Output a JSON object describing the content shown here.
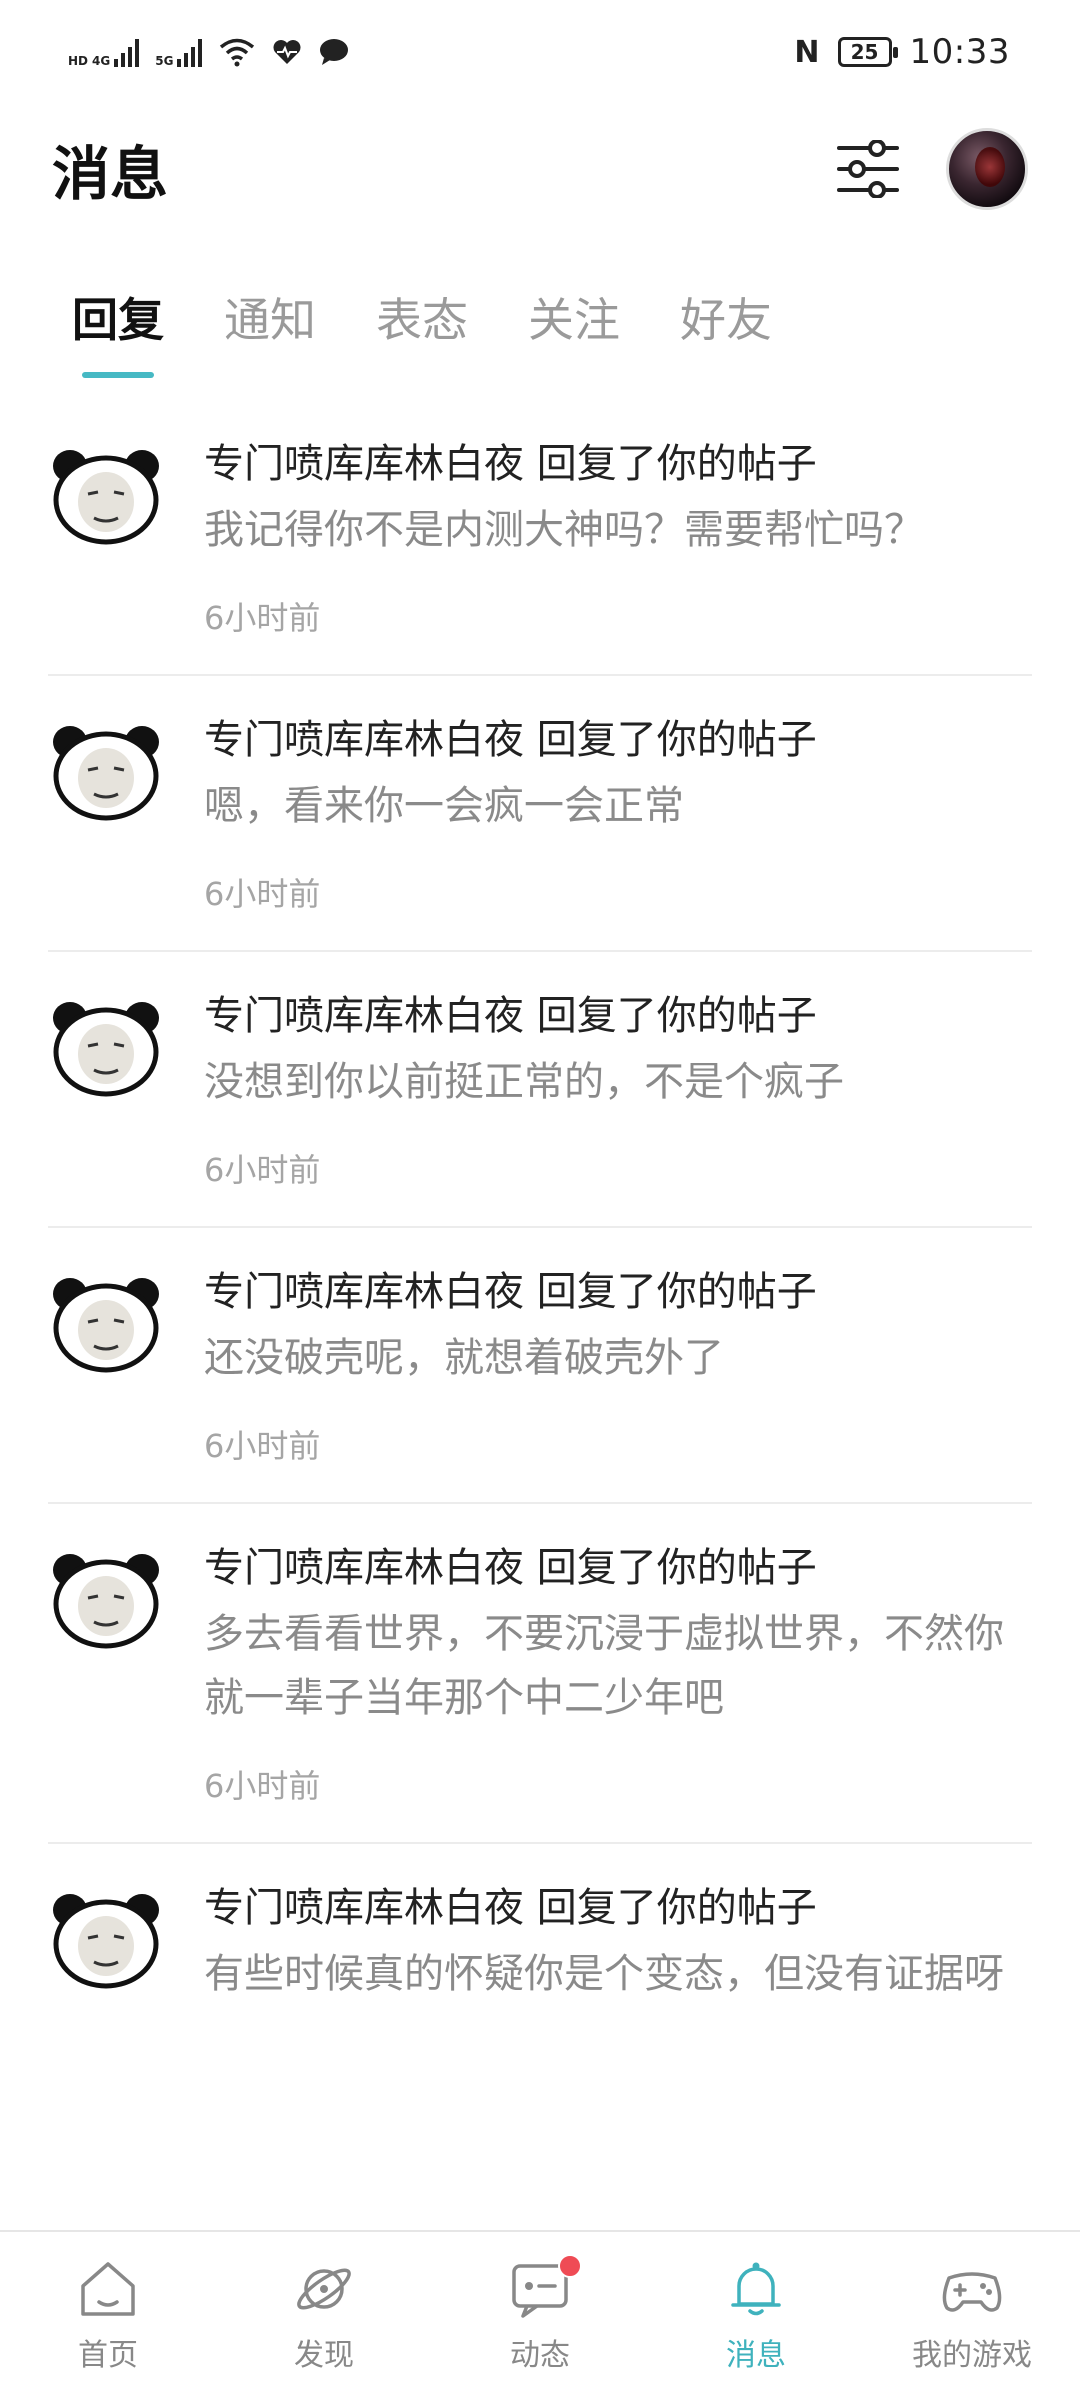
{
  "status_bar": {
    "time": "10:33",
    "battery": "25",
    "network_1": "4G",
    "network_2": "5G",
    "hd_label": "HD"
  },
  "header": {
    "title": "消息"
  },
  "tabs": [
    {
      "label": "回复",
      "active": true
    },
    {
      "label": "通知",
      "active": false
    },
    {
      "label": "表态",
      "active": false
    },
    {
      "label": "关注",
      "active": false
    },
    {
      "label": "好友",
      "active": false
    }
  ],
  "messages": [
    {
      "title": "专门喷库库林白夜 回复了你的帖子",
      "body": "我记得你不是内测大神吗？需要帮忙吗？",
      "time": "6小时前"
    },
    {
      "title": "专门喷库库林白夜 回复了你的帖子",
      "body": "嗯，看来你一会疯一会正常",
      "time": "6小时前"
    },
    {
      "title": "专门喷库库林白夜 回复了你的帖子",
      "body": "没想到你以前挺正常的，不是个疯子",
      "time": "6小时前"
    },
    {
      "title": "专门喷库库林白夜 回复了你的帖子",
      "body": "还没破壳呢，就想着破壳外了",
      "time": "6小时前"
    },
    {
      "title": "专门喷库库林白夜 回复了你的帖子",
      "body": "多去看看世界，不要沉浸于虚拟世界，不然你就一辈子当年那个中二少年吧",
      "time": "6小时前"
    },
    {
      "title": "专门喷库库林白夜 回复了你的帖子",
      "body": "有些时候真的怀疑你是个变态，但没有证据呀",
      "time": ""
    }
  ],
  "bottom_nav": [
    {
      "label": "首页",
      "icon": "home-icon",
      "active": false
    },
    {
      "label": "发现",
      "icon": "planet-icon",
      "active": false
    },
    {
      "label": "动态",
      "icon": "chat-icon",
      "active": false,
      "badge": true
    },
    {
      "label": "消息",
      "icon": "bell-icon",
      "active": true
    },
    {
      "label": "我的游戏",
      "icon": "gamepad-icon",
      "active": false
    }
  ],
  "colors": {
    "accent": "#46b9c4",
    "badge": "#ef4b55"
  }
}
